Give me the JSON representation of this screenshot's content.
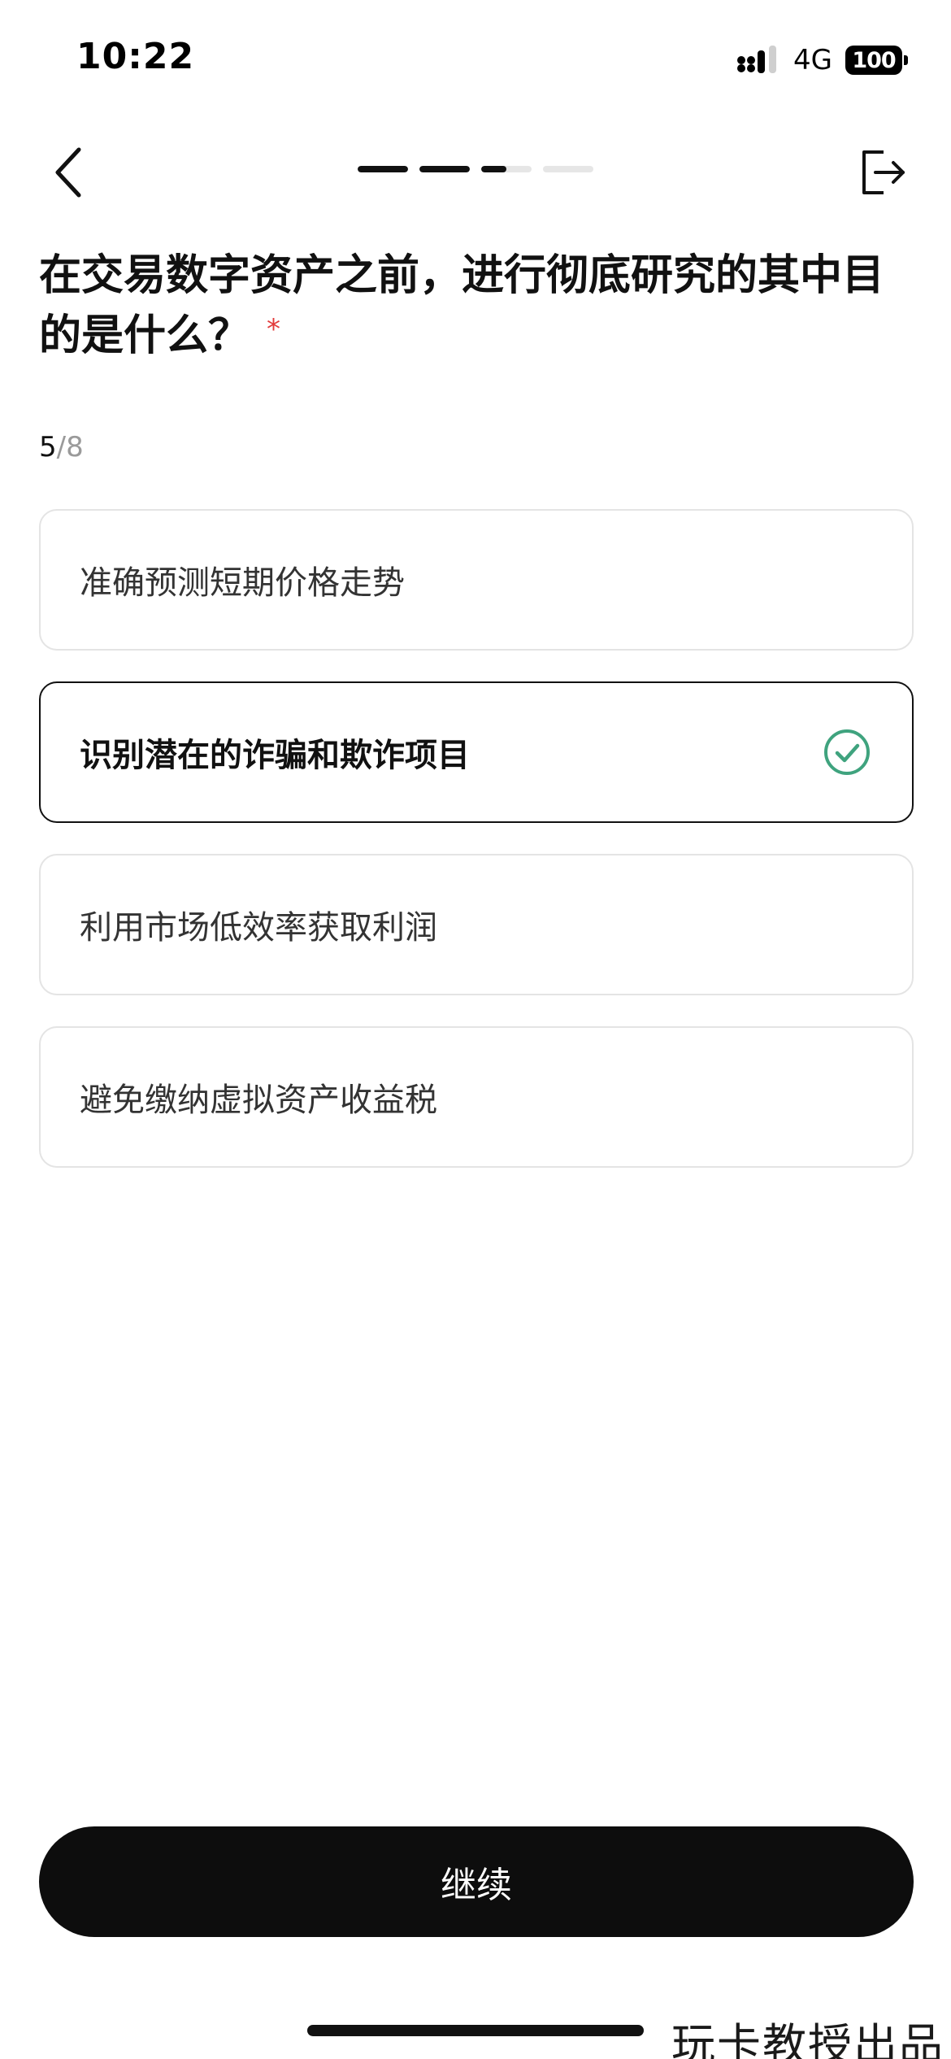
{
  "status_bar": {
    "time": "10:22",
    "network": "4G",
    "battery": "100",
    "icons": [
      "signal-icon",
      "battery-icon"
    ]
  },
  "header": {
    "back_icon": "chevron-left-icon",
    "exit_icon": "exit-icon",
    "progress": {
      "steps": [
        1,
        1,
        0.5,
        0
      ],
      "accent": "#111111",
      "track": "#e6e6e6"
    }
  },
  "question": {
    "title": "在交易数字资产之前，进行彻底研究的其中目的是什么？",
    "required_mark": "*",
    "current": "5",
    "separator": "/",
    "total": "8"
  },
  "options": [
    {
      "label": "准确预测短期价格走势",
      "selected": false
    },
    {
      "label": "识别潜在的诈骗和欺诈项目",
      "selected": true
    },
    {
      "label": "利用市场低效率获取利润",
      "selected": false
    },
    {
      "label": "避免缴纳虚拟资产收益税",
      "selected": false
    }
  ],
  "colors": {
    "check": "#3fa37e",
    "required": "#e23b3b",
    "button_bg": "#0d0d0d"
  },
  "continue_label": "继续",
  "watermark": "玩卡教授出品"
}
